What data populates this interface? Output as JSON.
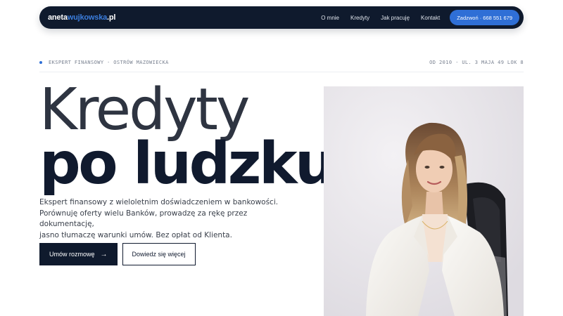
{
  "nav": {
    "logo_part1": "aneta",
    "logo_part2": "wujkowska",
    "logo_part3": ".pl",
    "links": [
      "O mnie",
      "Kredyty",
      "Jak pracuję",
      "Kontakt"
    ],
    "cta": "Zadzwoń · 668 551 679"
  },
  "meta": {
    "left": "EKSPERT FINANSOWY · OSTRÓW MAZOWIECKA",
    "right": "OD 2010 · UL. 3 MAJA 49 LOK 8"
  },
  "hero": {
    "line1": "Kredyty",
    "line2": "po ludzku",
    "dot": ".",
    "lead_lines": [
      "Ekspert finansowy z wieloletnim doświadczeniem w bankowości.",
      "Porównuję oferty wielu Banków, prowadzę za rękę przez dokumentację,",
      "jasno tłumaczę warunki umów. Bez opłat od Klienta."
    ],
    "primary_button": "Umów rozmowę",
    "primary_button_icon": "→",
    "secondary_button": "Dowiedz się więcej"
  },
  "colors": {
    "navy": "#0f1a2d",
    "accent": "#2f6fd6",
    "text": "#101a2e"
  }
}
